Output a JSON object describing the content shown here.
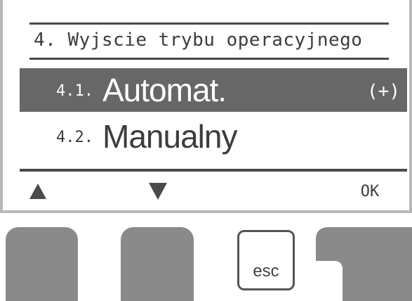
{
  "header": {
    "title": "4. Wyjscie trybu operacyjnego"
  },
  "menu": {
    "items": [
      {
        "number": "4.1.",
        "label": "Automat.",
        "marker": "(+)",
        "selected": true
      },
      {
        "number": "4.2.",
        "label": "Manualny",
        "marker": "",
        "selected": false
      }
    ]
  },
  "softkeys": {
    "up_icon": "triangle-up-icon",
    "down_icon": "triangle-down-icon",
    "ok_label": "OK"
  },
  "hardware": {
    "esc_label": "esc"
  },
  "colors": {
    "highlight": "#676767",
    "text": "#3c3c3c",
    "button": "#8a8a8a",
    "frame": "#b9b9b9"
  }
}
